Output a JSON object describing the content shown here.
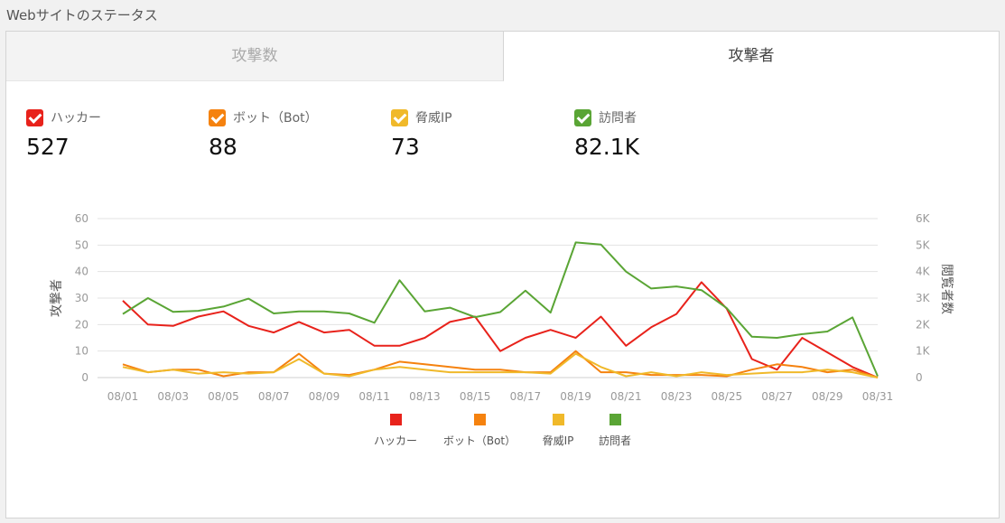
{
  "section_title": "Webサイトのステータス",
  "tabs": [
    {
      "label": "攻撃数",
      "active": false
    },
    {
      "label": "攻撃者",
      "active": true
    }
  ],
  "stats": [
    {
      "label": "ハッカー",
      "value": "527",
      "color": "#e8221b"
    },
    {
      "label": "ボット（Bot）",
      "value": "88",
      "color": "#f5820f"
    },
    {
      "label": "脅威IP",
      "value": "73",
      "color": "#f0b92a"
    },
    {
      "label": "訪問者",
      "value": "82.1K",
      "color": "#5aa535"
    }
  ],
  "chart_data": {
    "type": "line",
    "x": [
      "08/01",
      "08/02",
      "08/03",
      "08/04",
      "08/05",
      "08/06",
      "08/07",
      "08/08",
      "08/09",
      "08/10",
      "08/11",
      "08/12",
      "08/13",
      "08/14",
      "08/15",
      "08/16",
      "08/17",
      "08/18",
      "08/19",
      "08/20",
      "08/21",
      "08/22",
      "08/23",
      "08/24",
      "08/25",
      "08/26",
      "08/27",
      "08/28",
      "08/29",
      "08/30",
      "08/31"
    ],
    "x_tick_labels": [
      "08/01",
      "08/03",
      "08/05",
      "08/07",
      "08/09",
      "08/11",
      "08/13",
      "08/15",
      "08/17",
      "08/19",
      "08/21",
      "08/23",
      "08/25",
      "08/27",
      "08/29",
      "08/31"
    ],
    "ylabel": "攻撃者",
    "y2label": "閲覧者数",
    "ylim": [
      0,
      60
    ],
    "yticks": [
      0,
      10,
      20,
      30,
      40,
      50,
      60
    ],
    "y2lim": [
      0,
      6000
    ],
    "y2ticks": [
      "0",
      "1K",
      "2K",
      "3K",
      "4K",
      "5K",
      "6K"
    ],
    "grid": true,
    "legend_position": "bottom",
    "series": [
      {
        "name": "ハッカー",
        "axis": "left",
        "color": "#e8221b",
        "values": [
          29,
          20,
          19.5,
          23,
          25,
          19.5,
          17,
          21,
          17,
          18,
          12,
          12,
          15,
          21,
          23,
          10,
          15,
          18,
          15,
          23,
          12,
          19,
          24,
          36,
          26,
          7,
          3,
          15,
          9.5,
          4,
          0
        ]
      },
      {
        "name": "ボット（Bot）",
        "axis": "left",
        "color": "#f5820f",
        "values": [
          5,
          2,
          3,
          3,
          0.5,
          2,
          2,
          9,
          1.5,
          1,
          3,
          6,
          5,
          4,
          3,
          3,
          2,
          2,
          10,
          2,
          2,
          1,
          1,
          1,
          0.5,
          3,
          5,
          4,
          2,
          3,
          0
        ]
      },
      {
        "name": "脅威IP",
        "axis": "left",
        "color": "#f0b92a",
        "values": [
          4,
          2,
          3,
          1.5,
          2,
          1.5,
          2,
          7,
          1.5,
          0.5,
          3,
          4,
          3,
          2,
          2,
          2,
          2,
          1.5,
          9,
          4,
          0.5,
          2,
          0.5,
          2,
          1,
          1.5,
          2,
          2,
          3,
          2,
          0
        ]
      },
      {
        "name": "訪問者",
        "axis": "right",
        "color": "#5aa535",
        "values": [
          2400,
          3000,
          2480,
          2520,
          2680,
          2980,
          2420,
          2500,
          2500,
          2420,
          2070,
          3670,
          2500,
          2640,
          2280,
          2470,
          3280,
          2450,
          5100,
          5020,
          4000,
          3360,
          3440,
          3300,
          2620,
          1540,
          1500,
          1640,
          1740,
          2270,
          50
        ]
      }
    ]
  }
}
